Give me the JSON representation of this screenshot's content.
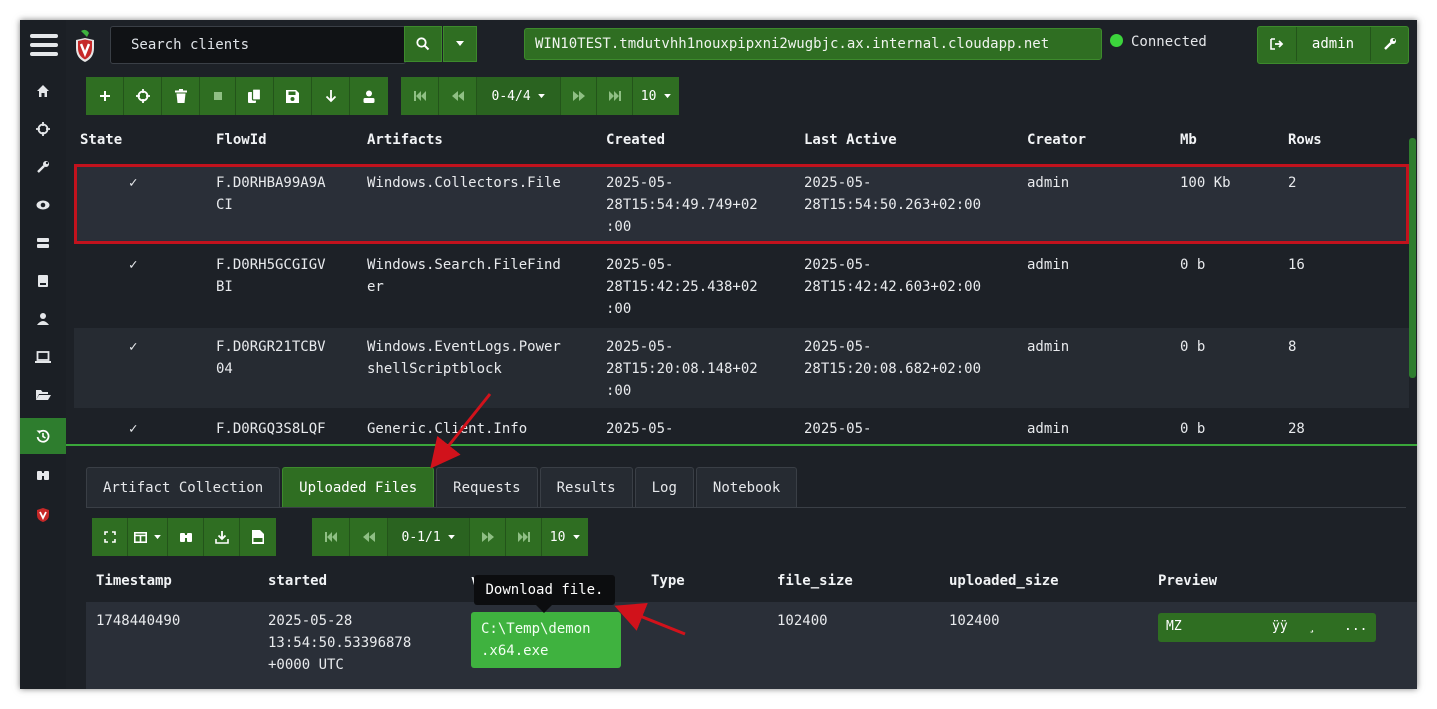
{
  "header": {
    "search_placeholder": "Search clients",
    "hostname": "WIN10TEST.tmdutvhh1nouxpipxni2wugbjc.ax.internal.cloudapp.net",
    "status": "Connected",
    "user": "admin"
  },
  "flows_toolbar": {
    "pager": "0-4/4",
    "page_size": "10"
  },
  "flows_table": {
    "columns": [
      "State",
      "FlowId",
      "Artifacts",
      "Created",
      "Last Active",
      "Creator",
      "Mb",
      "Rows"
    ],
    "rows": [
      {
        "state": "✓",
        "flow_id": [
          "F.D0RHBA99A9A",
          "CI"
        ],
        "artifacts": [
          "Windows.Collectors.File"
        ],
        "created": [
          "2025-05-",
          "28T15:54:49.749+02",
          ":00"
        ],
        "last_active": [
          "2025-05-",
          "28T15:54:50.263+02:00"
        ],
        "creator": "admin",
        "mb": "100 Kb",
        "rows": "2"
      },
      {
        "state": "✓",
        "flow_id": [
          "F.D0RH5GCGIGV",
          "BI"
        ],
        "artifacts": [
          "Windows.Search.FileFind",
          "er"
        ],
        "created": [
          "2025-05-",
          "28T15:42:25.438+02",
          ":00"
        ],
        "last_active": [
          "2025-05-",
          "28T15:42:42.603+02:00"
        ],
        "creator": "admin",
        "mb": "0 b",
        "rows": "16"
      },
      {
        "state": "✓",
        "flow_id": [
          "F.D0RGR21TCBV",
          "04"
        ],
        "artifacts": [
          "Windows.EventLogs.Power",
          "shellScriptblock"
        ],
        "created": [
          "2025-05-",
          "28T15:20:08.148+02",
          ":00"
        ],
        "last_active": [
          "2025-05-",
          "28T15:20:08.682+02:00"
        ],
        "creator": "admin",
        "mb": "0 b",
        "rows": "8"
      },
      {
        "state": "✓",
        "flow_id": [
          "F.D0RGQ3S8LQF"
        ],
        "artifacts": [
          "Generic.Client.Info"
        ],
        "created": [
          "2025-05-"
        ],
        "last_active": [
          "2025-05-"
        ],
        "creator": "admin",
        "mb": "0 b",
        "rows": "28"
      }
    ]
  },
  "tabs": [
    "Artifact Collection",
    "Uploaded Files",
    "Requests",
    "Results",
    "Log",
    "Notebook"
  ],
  "uploads_toolbar": {
    "pager": "0-1/1",
    "page_size": "10"
  },
  "uploads_table": {
    "columns": [
      "Timestamp",
      "started",
      "v",
      "Type",
      "file_size",
      "uploaded_size",
      "Preview"
    ],
    "row": {
      "timestamp": "1748440490",
      "started": [
        "2025-05-28",
        "13:54:50.53396878",
        "+0000 UTC"
      ],
      "vfs_path": [
        "C:\\Temp\\demon",
        ".x64.exe"
      ],
      "file_size": "102400",
      "uploaded_size": "102400",
      "preview": [
        "MZ",
        "ÿÿ",
        "¸",
        "..."
      ]
    }
  },
  "tooltip": "Download file.",
  "colors": {
    "accent": "#2f6e22",
    "highlight": "#c2121d",
    "arrow": "#d1121b",
    "link_button": "#3fb23f",
    "status_dot": "#3cd43c"
  }
}
